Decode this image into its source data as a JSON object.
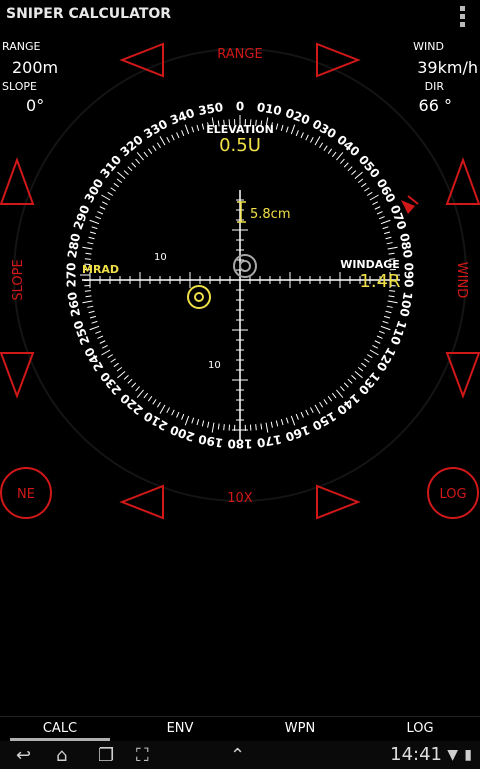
{
  "app": {
    "title": "SNIPER CALCULATOR"
  },
  "readouts": {
    "range": {
      "label": "RANGE",
      "value": "200",
      "unit": "m"
    },
    "slope": {
      "label": "SLOPE",
      "value": "0",
      "unit": "°"
    },
    "wind": {
      "label": "WIND",
      "value": "39",
      "unit": "km/h"
    },
    "dir": {
      "label": "DIR",
      "value": "66",
      "unit": "°"
    }
  },
  "controls": {
    "range_label": "RANGE",
    "slope_label": "SLOPE",
    "wind_label": "WIND",
    "zoom_label": "10X",
    "ne_button": "NE",
    "log_button": "LOG"
  },
  "reticle": {
    "elevation_label": "ELEVATION",
    "elevation_value": "0.5U",
    "windage_label": "WINDAGE",
    "windage_value": "1.4R",
    "mrad_label": "MRAD",
    "size_label": "5.8cm",
    "tick_10_left": "10",
    "tick_10_bottom": "10",
    "compass": [
      "0",
      "010",
      "020",
      "030",
      "040",
      "050",
      "060",
      "070",
      "080",
      "090",
      "100",
      "110",
      "120",
      "130",
      "140",
      "150",
      "160",
      "170",
      "180",
      "190",
      "200",
      "210",
      "220",
      "230",
      "240",
      "250",
      "260",
      "270",
      "280",
      "290",
      "300",
      "310",
      "320",
      "330",
      "340",
      "350"
    ]
  },
  "tabs": [
    "CALC",
    "ENV",
    "WPN",
    "LOG"
  ],
  "status": {
    "time": "14:41"
  },
  "colors": {
    "accent_red": "#d01818",
    "reticle_yellow": "#f0e048",
    "background": "#000000"
  }
}
